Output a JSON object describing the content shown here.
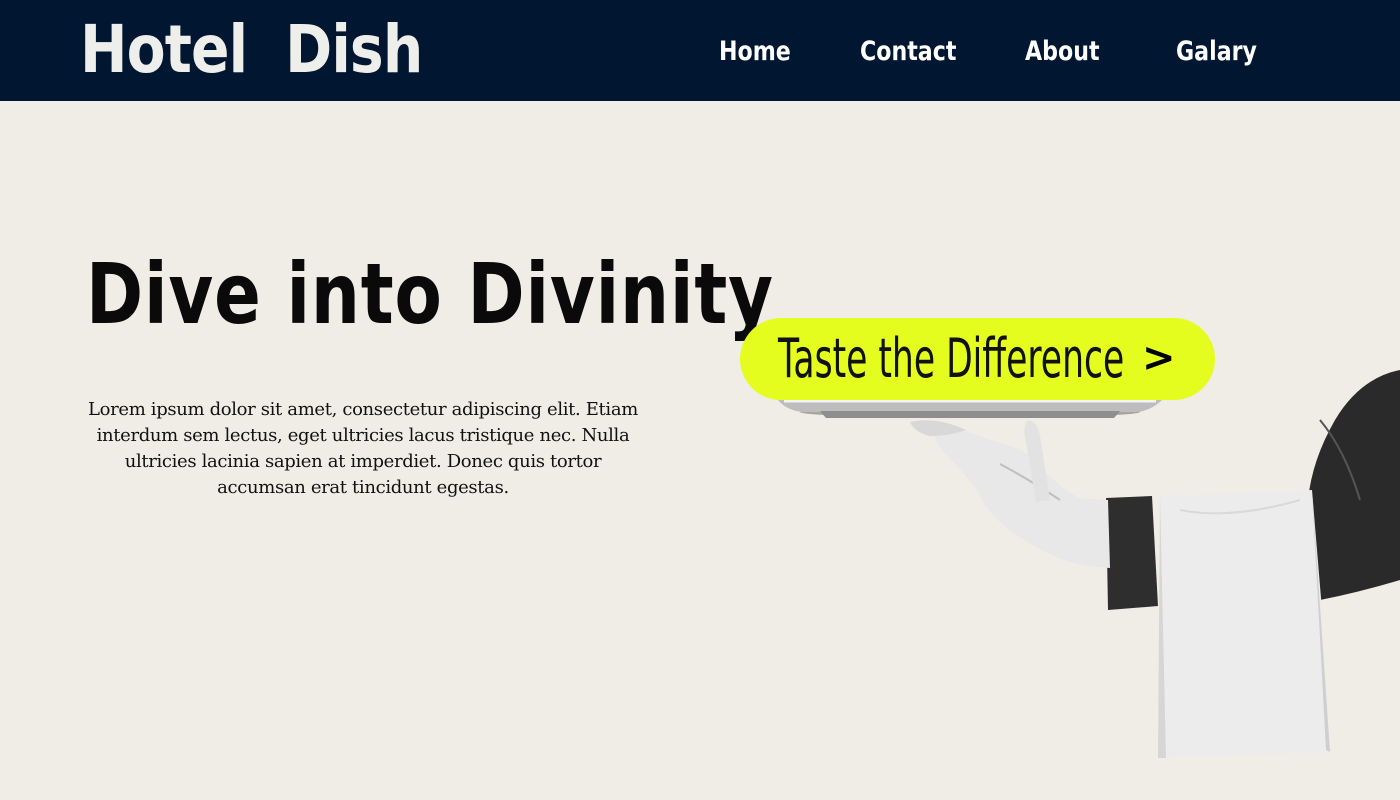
{
  "header": {
    "brand": "Hotel  Dish",
    "nav": {
      "home": "Home",
      "contact": "Contact",
      "about": "About",
      "galary": "Galary"
    }
  },
  "hero": {
    "title": "Dive into Divinity",
    "text": "Lorem ipsum dolor sit amet, consectetur adipiscing elit. Etiam interdum sem lectus, eget ultricies lacus tristique nec. Nulla ultricies lacinia sapien at imperdiet. Donec quis tortor accumsan erat tincidunt egestas.",
    "cta_label": "Taste the Difference",
    "cta_arrow": ">"
  },
  "colors": {
    "header_bg": "#011631",
    "page_bg": "#efede6",
    "cta_bg": "#e4fd1e"
  },
  "icons": {
    "cta_arrow": "chevron-right-icon",
    "illustration": "waiter-serving-tray"
  }
}
